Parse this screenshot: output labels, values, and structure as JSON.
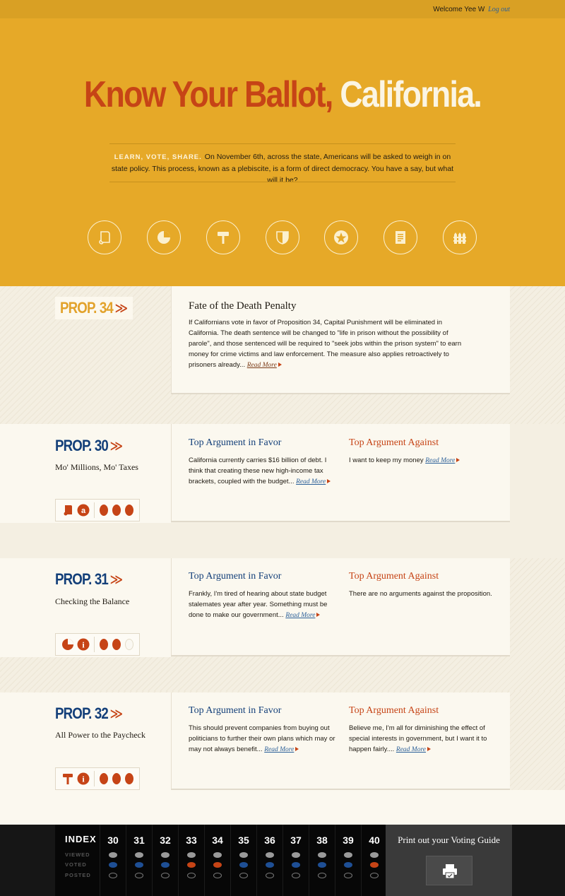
{
  "header": {
    "welcome": "Welcome Yee W",
    "logout": "Log out",
    "title_part1": "Know Your Ballot,",
    "title_part2": "California.",
    "intro_lead": "LEARN, VOTE, SHARE.",
    "intro_text": "On November 6th, across the state, Americans will be asked to weigh in on state policy. This process, known as a plebiscite, is a form of direct democracy. You have a say, but what will it be?",
    "category_icons": [
      "scroll-icon",
      "pie-chart-icon",
      "hammer-icon",
      "shield-icon",
      "star-badge-icon",
      "document-icon",
      "fence-icon"
    ]
  },
  "featured": {
    "prop_label": "PROP. 34",
    "title": "Fate of the Death Penalty",
    "text": "If Californians vote in favor of Proposition 34, Capital Punishment will be eliminated in California. The death sentence will be changed to \"life in prison without the possibility of parole\", and those sentenced will be required to \"seek jobs within the prison system\" to earn money for crime victims and law enforcement. The measure also applies retroactively to prisoners already...",
    "read_more": "Read More"
  },
  "props": [
    {
      "label": "PROP. 30",
      "name": "Mo' Millions, Mo' Taxes",
      "favor_title": "Top Argument in Favor",
      "favor_text": "California currently carries $16 billion of debt. I think that creating these new high-income tax brackets, coupled with the budget...",
      "against_title": "Top Argument Against",
      "against_text": "I want to keep my money",
      "read_more": "Read More",
      "icons": [
        "scroll-icon",
        "a-letter-icon"
      ],
      "dots_filled": 3
    },
    {
      "label": "PROP. 31",
      "name": "Checking the Balance",
      "favor_title": "Top Argument in Favor",
      "favor_text": "Frankly, I'm tired of hearing about state budget stalemates year after year. Something must be done to make our government...",
      "against_title": "Top Argument Against",
      "against_text": "There are no arguments against the proposition.",
      "read_more": "Read More",
      "icons": [
        "pie-chart-icon",
        "info-icon"
      ],
      "dots_filled": 2
    },
    {
      "label": "PROP. 32",
      "name": "All Power to the Paycheck",
      "favor_title": "Top Argument in Favor",
      "favor_text": "This should prevent companies from buying out politicians to further their own plans which may or may not always benefit...",
      "against_title": "Top Argument Against",
      "against_text": "Believe me, I'm all for diminishing the effect of special interests in government, but I want it to happen fairly....",
      "read_more": "Read More",
      "icons": [
        "hammer-icon",
        "info-icon"
      ],
      "dots_filled": 3
    }
  ],
  "footer": {
    "index_label": "INDEX",
    "rows": [
      "VIEWED",
      "VOTED",
      "POSTED"
    ],
    "columns": [
      {
        "num": "30",
        "voted": "blue"
      },
      {
        "num": "31",
        "voted": "blue"
      },
      {
        "num": "32",
        "voted": "blue"
      },
      {
        "num": "33",
        "voted": "orange"
      },
      {
        "num": "34",
        "voted": "orange"
      },
      {
        "num": "35",
        "voted": "blue"
      },
      {
        "num": "36",
        "voted": "blue"
      },
      {
        "num": "37",
        "voted": "blue"
      },
      {
        "num": "38",
        "voted": "blue"
      },
      {
        "num": "39",
        "voted": "blue"
      },
      {
        "num": "40",
        "voted": "orange"
      }
    ],
    "print_label": "Print out your Voting Guide"
  },
  "colors": {
    "gold": "#e6a928",
    "rust": "#c64416",
    "navy": "#133f79",
    "cream": "#faf6ec"
  }
}
